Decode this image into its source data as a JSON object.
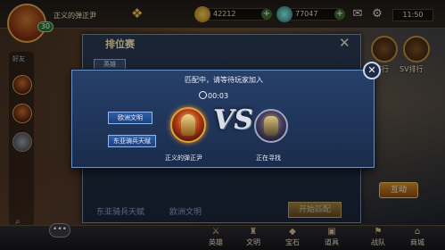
{
  "topbar": {
    "player_name": "正义的弹正尹",
    "level": "30",
    "gold": "42212",
    "gems": "77047",
    "clock": "11:50"
  },
  "left": {
    "friends_label": "好友"
  },
  "right_menu": {
    "rank_label": "排行",
    "sv_label": "SV排行",
    "interact_label": "互动"
  },
  "bottom_nav": [
    "英雄",
    "文明",
    "宝石",
    "道具",
    "战队",
    "商城"
  ],
  "ranked_panel": {
    "title": "排位赛",
    "tab_label": "英雄",
    "bottom_left": "东亚骑兵天赋",
    "bottom_mid": "欧洲文明",
    "start_label": "开始匹配"
  },
  "match_dialog": {
    "title": "匹配中，请等待玩家加入",
    "timer": "00:03",
    "tag_civ": "欧洲文明",
    "tag_talent": "东亚骑兵天赋",
    "vs_text": "VS",
    "player_name": "正义的弹正尹",
    "searching_text": "正在寻找",
    "close_label": "✕"
  },
  "colors": {
    "dialog_bg": "#27406a",
    "tag_blue": "#2f5fa6",
    "hero_ring": "#e2a23a"
  }
}
